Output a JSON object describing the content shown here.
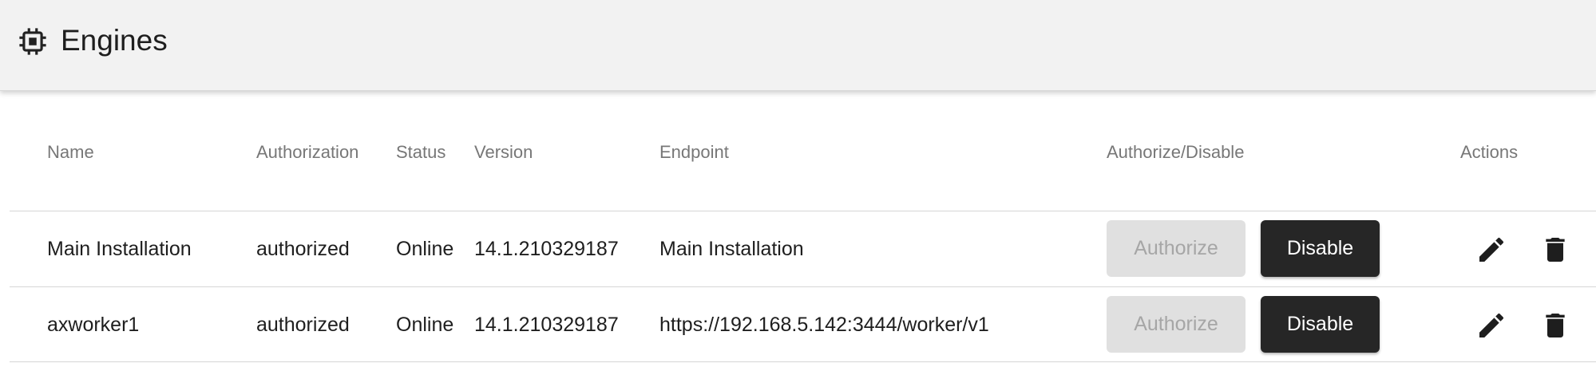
{
  "header": {
    "title": "Engines",
    "icon": "chip-icon"
  },
  "table": {
    "columns": [
      "Name",
      "Authorization",
      "Status",
      "Version",
      "Endpoint",
      "Authorize/Disable",
      "Actions"
    ],
    "rows": [
      {
        "name": "Main Installation",
        "authorization": "authorized",
        "status": "Online",
        "version": "14.1.210329187",
        "endpoint": "Main Installation",
        "authorize_label": "Authorize",
        "disable_label": "Disable"
      },
      {
        "name": "axworker1",
        "authorization": "authorized",
        "status": "Online",
        "version": "14.1.210329187",
        "endpoint": "https://192.168.5.142:3444/worker/v1",
        "authorize_label": "Authorize",
        "disable_label": "Disable"
      }
    ],
    "action_icons": [
      "edit-icon",
      "delete-icon"
    ]
  },
  "colors": {
    "header_bg": "#f2f2f2",
    "disable_button": "#262626",
    "authorize_button_disabled": "#e0e0e0"
  }
}
